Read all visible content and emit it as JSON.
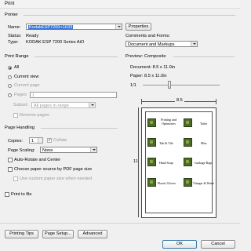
{
  "window": {
    "title": "Print"
  },
  "printer": {
    "group_label": "Printer",
    "name_label": "Name:",
    "name_value": "KodakESP7200+1633",
    "properties_button": "Properties",
    "status_label": "Status:",
    "status_value": "Ready",
    "type_label": "Type:",
    "type_value": "KODAK ESP 7200 Series AiO"
  },
  "comments": {
    "label": "Comments and Forms:",
    "value": "Document and Markups"
  },
  "print_range": {
    "group_label": "Print Range",
    "all": "All",
    "current_view": "Current view",
    "current_page": "Current page",
    "pages": "Pages",
    "pages_value": "1",
    "subset_label": "Subset:",
    "subset_value": "All pages in range",
    "reverse_pages": "Reverse pages"
  },
  "page_handling": {
    "group_label": "Page Handling",
    "copies_label": "Copies:",
    "copies_value": "1",
    "collate": "Collate",
    "scaling_label": "Page Scaling:",
    "scaling_value": "None",
    "auto_rotate": "Auto-Rotate and Center",
    "choose_source": "Choose paper source by PDF page size",
    "custom_paper": "Use custom paper size when needed"
  },
  "print_to_file": "Print to file",
  "preview": {
    "group_label": "Preview: Composite",
    "document_size": "Document: 8.5 x 11.0in",
    "paper_size": "Paper: 8.5 x 11.0in",
    "zoom": "1/1",
    "width_label": "8.5",
    "height_label": "11",
    "items": [
      {
        "text": "Printing and Optimizers"
      },
      {
        "text": "Toilet"
      },
      {
        "text": "Tub & Tile"
      },
      {
        "text": "Misc"
      },
      {
        "text": "Hand Soap"
      },
      {
        "text": "Garbage Bags"
      },
      {
        "text": "Plastic Gloves"
      },
      {
        "text": "Vinegar & Water"
      }
    ]
  },
  "buttons": {
    "printing_tips": "Printing Tips",
    "page_setup": "Page Setup...",
    "advanced": "Advanced",
    "ok": "OK",
    "cancel": "Cancel"
  }
}
